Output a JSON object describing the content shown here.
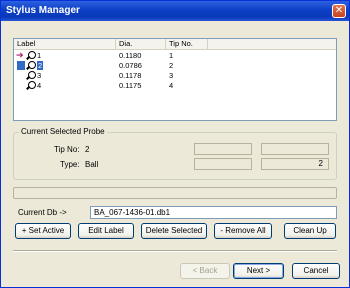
{
  "window": {
    "title": "Stylus Manager"
  },
  "list": {
    "columns": [
      "Label",
      "Dia.",
      "Tip No."
    ],
    "rows": [
      {
        "label": "1",
        "dia": "0.1180",
        "tip": "1",
        "current": true
      },
      {
        "label": "2",
        "dia": "0.0786",
        "tip": "2",
        "selected": true
      },
      {
        "label": "3",
        "dia": "0.1178",
        "tip": "3"
      },
      {
        "label": "4",
        "dia": "0.1175",
        "tip": "4"
      }
    ]
  },
  "current_probe": {
    "group_title": "Current Selected Probe",
    "tip_no_label": "Tip No:",
    "tip_no_value": "2",
    "type_label": "Type:",
    "type_value": "Ball",
    "type_count": "2"
  },
  "database": {
    "label": "Current Db ->",
    "value": "BA_067-1436-01.db1"
  },
  "actions": {
    "set_active": "+ Set Active",
    "edit_label": "Edit Label",
    "delete_selected": "Delete Selected",
    "remove_all": "- Remove All",
    "clean_up": "Clean Up"
  },
  "nav": {
    "back": "< Back",
    "next": "Next >",
    "cancel": "Cancel"
  }
}
